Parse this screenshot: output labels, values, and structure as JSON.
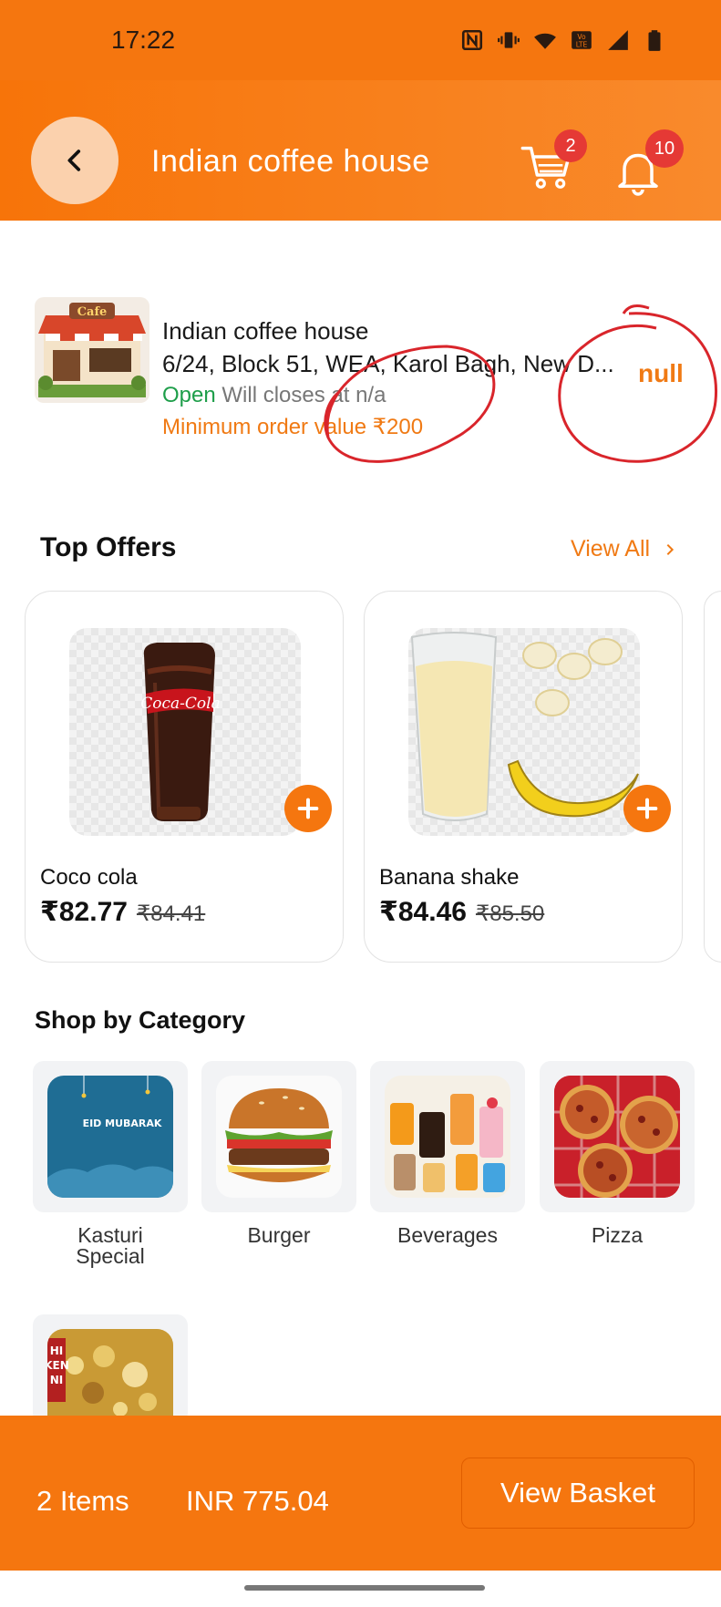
{
  "status_bar": {
    "time": "17:22"
  },
  "header": {
    "title": "Indian coffee house",
    "cart_count": "2",
    "notification_count": "10"
  },
  "store": {
    "name": "Indian coffee house",
    "address": "6/24, Block 51, WEA, Karol Bagh, New D...",
    "status_open": "Open",
    "status_closes": "Will closes at n/a",
    "min_order": "Minimum order value ₹200",
    "rating_value": "null"
  },
  "top_offers": {
    "title": "Top Offers",
    "view_all": "View All",
    "products": [
      {
        "name": "Coco cola",
        "price": "₹82.77",
        "old_price": "₹84.41"
      },
      {
        "name": "Banana shake",
        "price": "₹84.46",
        "old_price": "₹85.50"
      }
    ]
  },
  "categories": {
    "title": "Shop by Category",
    "items": [
      {
        "label": "Kasturi Special",
        "img_text": "EID MUBARAK"
      },
      {
        "label": "Burger"
      },
      {
        "label": "Beverages"
      },
      {
        "label": "Pizza"
      },
      {
        "label": "",
        "img_text": "HI KEN NI"
      }
    ]
  },
  "basket": {
    "items_count": "2 Items",
    "total": "INR 775.04",
    "button_label": "View Basket"
  },
  "colors": {
    "accent": "#f5760f",
    "open_green": "#1e9e4a",
    "badge_red": "#e53935",
    "annotation_red": "#d9252b"
  }
}
